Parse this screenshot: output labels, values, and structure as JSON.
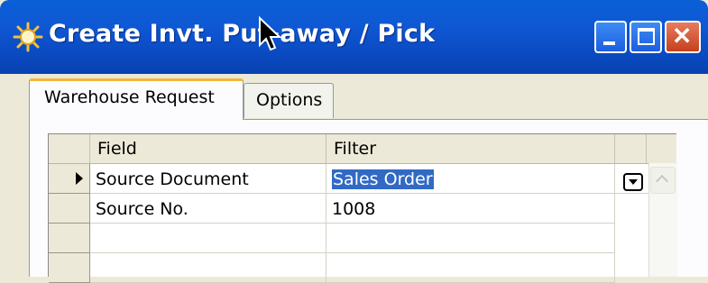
{
  "window": {
    "title": "Create Invt. Put-away / Pick",
    "icon": "gear-sparkle-icon",
    "buttons": [
      "minimize-icon",
      "maximize-icon",
      "close-icon"
    ]
  },
  "tabs": [
    {
      "label": "Warehouse Request",
      "active": true
    },
    {
      "label": "Options",
      "active": false
    }
  ],
  "grid": {
    "headers": [
      "Field",
      "Filter"
    ],
    "rows": [
      {
        "field": "Source Document",
        "filter": "Sales Order",
        "current": true
      },
      {
        "field": "Source No.",
        "filter": "1008",
        "current": false
      },
      {
        "field": "",
        "filter": "",
        "current": false
      },
      {
        "field": "",
        "filter": "",
        "current": false
      }
    ]
  },
  "colors": {
    "titlebar": "#0a5fd6",
    "selection": "#316ac5",
    "tab_highlight": "#f4b73a",
    "close_button": "#d9552e"
  }
}
